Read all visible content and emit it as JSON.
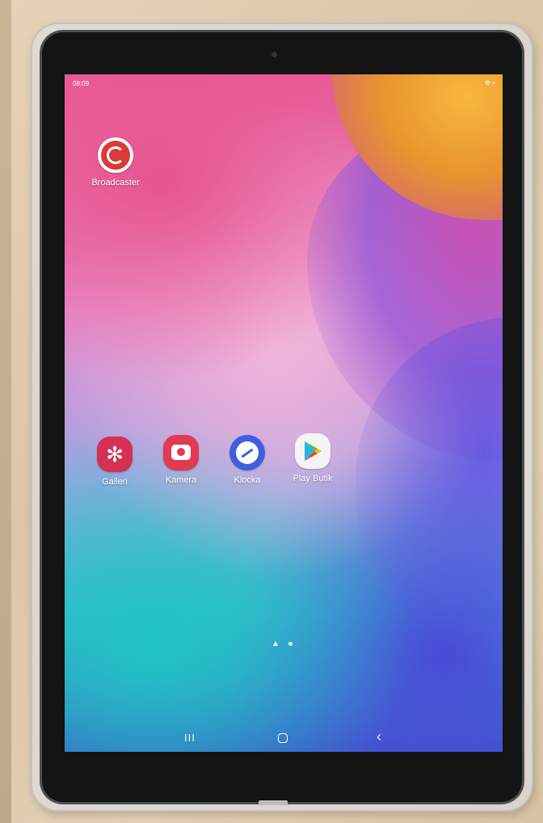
{
  "status_bar": {
    "time": "08:09",
    "icons": "⚙ ▪"
  },
  "apps": [
    {
      "label": "Broadcaster",
      "icon": "broadcaster-icon"
    },
    {
      "label": "Galleri",
      "icon": "flower-icon"
    },
    {
      "label": "Kamera",
      "icon": "camera-icon"
    },
    {
      "label": "Klocka",
      "icon": "clock-icon"
    },
    {
      "label": "Play Butik",
      "icon": "play-store-icon"
    }
  ],
  "page_indicator": {
    "pages": 2,
    "current": 1
  },
  "nav_bar": {
    "recent_glyph": "III",
    "back_glyph": "‹"
  },
  "colors": {
    "wallpaper_pink": "#e85b97",
    "wallpaper_cyan": "#21c4c4",
    "wallpaper_blue": "#4a49d8",
    "broadcaster_red": "#d93a3a",
    "galleri_red": "#d52f54",
    "kamera_red": "#e23a52",
    "klocka_blue": "#3f5fe0"
  }
}
